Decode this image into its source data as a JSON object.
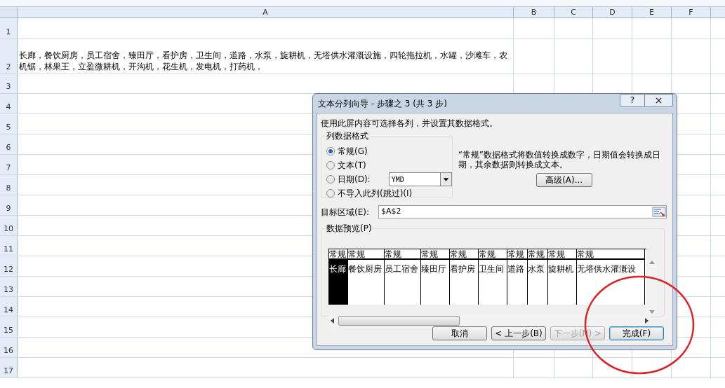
{
  "sheet": {
    "columns": [
      "A",
      "B",
      "C",
      "D",
      "E",
      "F"
    ],
    "row_numbers": [
      "1",
      "2",
      "3",
      "4",
      "5",
      "6",
      "7",
      "8",
      "9",
      "10",
      "11",
      "12",
      "13",
      "14",
      "15",
      "16",
      "17"
    ],
    "cell_a2": "长廊，餐饮厨房，员工宿舍，臻田厅，看护房，卫生间，道路，水泵，旋耕机，无塔供水灌溉设施，四轮拖拉机，水罐，沙滩车，农机锯，林果王，立盈微耕机，开沟机，花生机，发电机，打药机，"
  },
  "dialog": {
    "title": "文本分列向导 - 步骤之 3 (共 3 步)",
    "help": "?",
    "close": "×",
    "instruction": "使用此屏内容可选择各列，并设置其数据格式。",
    "format_group": {
      "label": "列数据格式",
      "options": [
        {
          "label": "常规(G)",
          "selected": true
        },
        {
          "label": "文本(T)",
          "selected": false
        },
        {
          "label": "日期(D):",
          "selected": false
        },
        {
          "label": "不导入此列(跳过)(I)",
          "selected": false
        }
      ],
      "date_format": "YMD"
    },
    "description": "“常规”数据格式将数值转换成数字，日期值会转换成日期，其余数据则转换成文本。",
    "advanced_button": "高级(A)...",
    "destination": {
      "label": "目标区域(E):",
      "value": "$A$2"
    },
    "preview": {
      "label": "数据预览(P)",
      "columns": [
        {
          "header": "常规",
          "value": "长廊",
          "selected": true
        },
        {
          "header": "常规",
          "value": "餐饮厨房",
          "selected": false
        },
        {
          "header": "常规",
          "value": "员工宿舍",
          "selected": false
        },
        {
          "header": "常规",
          "value": "臻田厅",
          "selected": false
        },
        {
          "header": "常规",
          "value": "看护房",
          "selected": false
        },
        {
          "header": "常规",
          "value": "卫生间",
          "selected": false
        },
        {
          "header": "常规",
          "value": "道路",
          "selected": false
        },
        {
          "header": "常规",
          "value": "水泵",
          "selected": false
        },
        {
          "header": "常规",
          "value": "旋耕机",
          "selected": false
        },
        {
          "header": "常规",
          "value": "无塔供水灌溉设",
          "selected": false
        }
      ]
    },
    "buttons": [
      {
        "label": "取消",
        "disabled": false,
        "default": false
      },
      {
        "label": "< 上一步(B)",
        "disabled": false,
        "default": false
      },
      {
        "label": "下一步(N) >",
        "disabled": true,
        "default": false
      },
      {
        "label": "完成(F)",
        "disabled": false,
        "default": true
      }
    ]
  }
}
